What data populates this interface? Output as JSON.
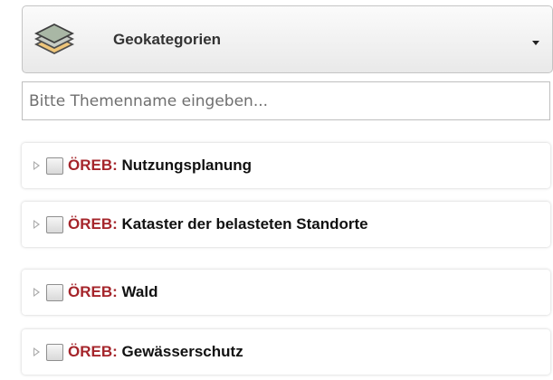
{
  "dropdown": {
    "label": "Geokategorien",
    "icon": "layers-icon"
  },
  "search": {
    "placeholder": "Bitte Themenname eingeben..."
  },
  "topics": [
    {
      "prefix": "ÖREB:",
      "name": "Nutzungsplanung"
    },
    {
      "prefix": "ÖREB:",
      "name": "Kataster der belasteten Standorte"
    },
    {
      "prefix": "ÖREB:",
      "name": "Wald"
    },
    {
      "prefix": "ÖREB:",
      "name": "Gewässerschutz"
    }
  ],
  "colors": {
    "prefix": "#a5252b",
    "layer_top": "#a9b7a5",
    "layer_bottom": "#efc67a"
  }
}
